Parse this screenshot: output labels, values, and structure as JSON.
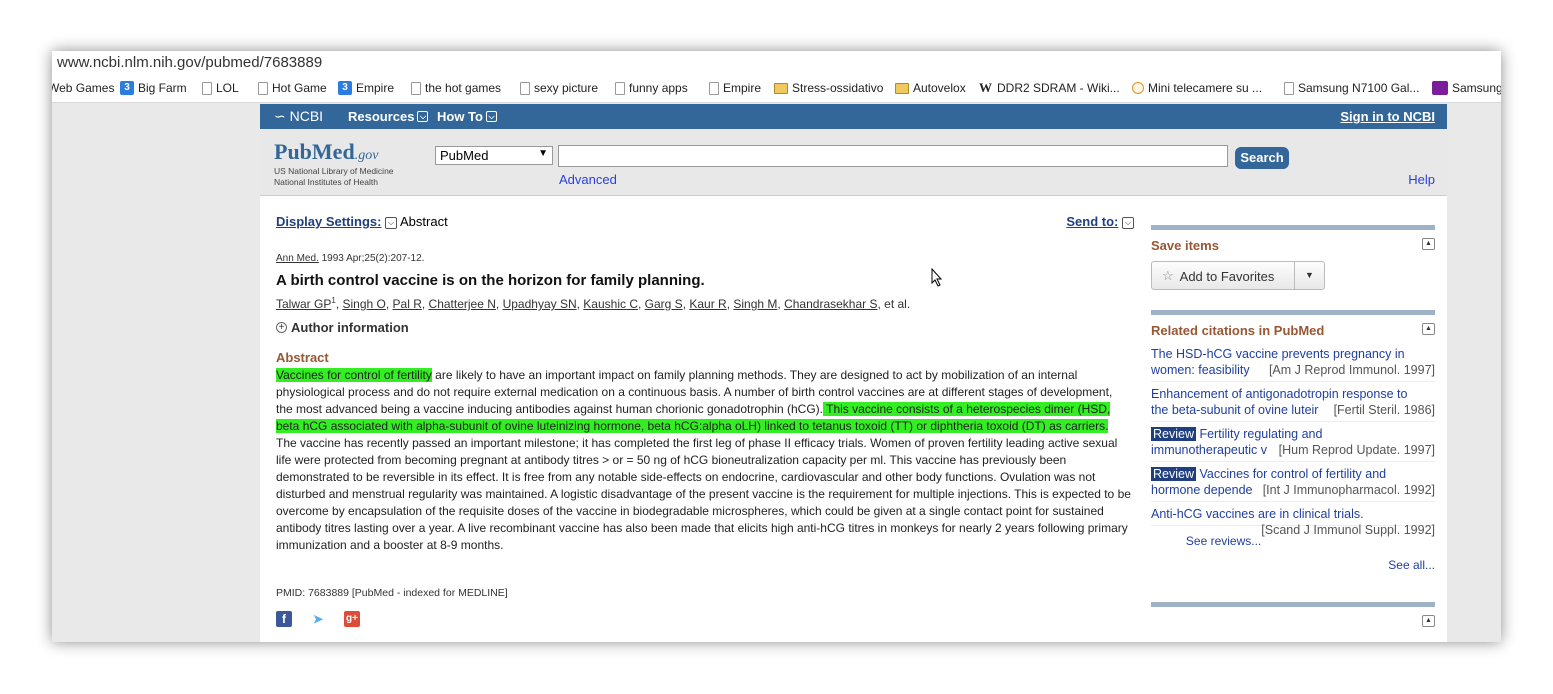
{
  "browser": {
    "url": "www.ncbi.nlm.nih.gov/pubmed/7683889",
    "bookmarks": [
      {
        "label": "Web Games",
        "icon": "page-icon"
      },
      {
        "label": "Big Farm",
        "icon": "game-icon"
      },
      {
        "label": "LOL",
        "icon": "page-icon"
      },
      {
        "label": "Hot Game",
        "icon": "page-icon"
      },
      {
        "label": "Empire",
        "icon": "game-icon"
      },
      {
        "label": "the hot games",
        "icon": "page-icon"
      },
      {
        "label": "sexy picture",
        "icon": "page-icon"
      },
      {
        "label": "funny apps",
        "icon": "page-icon"
      },
      {
        "label": "Empire",
        "icon": "page-icon"
      },
      {
        "label": "Stress-ossidativo",
        "icon": "folder-icon"
      },
      {
        "label": "Autovelox",
        "icon": "folder-icon"
      },
      {
        "label": "DDR2 SDRAM - Wiki...",
        "icon": "wikipedia-icon"
      },
      {
        "label": "Mini telecamere su ...",
        "icon": "camera-icon"
      },
      {
        "label": "Samsung N7100 Gal...",
        "icon": "page-icon"
      },
      {
        "label": "Samsung",
        "icon": "samsung-icon"
      }
    ]
  },
  "ncbi": {
    "logo": "NCBI",
    "resources": "Resources",
    "howto": "How To",
    "signin": "Sign in to NCBI"
  },
  "search": {
    "logo_pub": "Pub",
    "logo_med": "Med",
    "logo_gov": ".gov",
    "logo_sub1": "US National Library of Medicine",
    "logo_sub2": "National Institutes of Health",
    "db": "PubMed",
    "query": "",
    "button": "Search",
    "advanced": "Advanced",
    "help": "Help"
  },
  "article": {
    "display_settings": "Display Settings:",
    "format": "Abstract",
    "send_to": "Send to:",
    "journal": "Ann Med.",
    "citation": "1993 Apr;25(2):207-12.",
    "title": "A birth control vaccine is on the horizon for family planning.",
    "authors": [
      "Talwar GP",
      "Singh O",
      "Pal R",
      "Chatterjee N",
      "Upadhyay SN",
      "Kaushic C",
      "Garg S",
      "Kaur R",
      "Singh M",
      "Chandrasekhar S"
    ],
    "first_author_sup": "1",
    "et_al": ", et al.",
    "author_info": "Author information",
    "abstract_heading": "Abstract",
    "abstract_parts": [
      {
        "text": "Vaccines for control of fertility",
        "highlight": true
      },
      {
        "text": " are likely to have an important impact on family planning methods. They are designed to act by mobilization of an internal physiological process and do not require external medication on a continuous basis. A number of birth control vaccines are at different stages of development, the most advanced being a vaccine inducing antibodies against human chorionic gonadotrophin (hCG).",
        "highlight": false
      },
      {
        "text": " This vaccine consists of a heterospecies dimer (HSD, beta hCG associated with alpha-subunit of ovine luteinizing hormone, beta hCG:alpha oLH) linked to tetanus toxoid (TT) or diphtheria toxoid (DT) as carriers.",
        "highlight": true
      },
      {
        "text": " The vaccine has recently passed an important milestone; it has completed the first leg of phase II efficacy trials. Women of proven fertility leading active sexual life were protected from becoming pregnant at antibody titres > or = 50 ng of hCG bioneutralization capacity per ml. This vaccine has previously been demonstrated to be reversible in its effect. It is free from any notable side-effects on endocrine, cardiovascular and other body functions. Ovulation was not disturbed and menstrual regularity was maintained. A logistic disadvantage of the present vaccine is the requirement for multiple injections. This is expected to be overcome by encapsulation of the requisite doses of the vaccine in biodegradable microspheres, which could be given at a single contact point for sustained antibody titres lasting over a year. A live recombinant vaccine has also been made that elicits high anti-hCG titres in monkeys for nearly 2 years following primary immunization and a booster at 8-9 months.",
        "highlight": false
      }
    ],
    "pmid": "PMID: 7683889 [PubMed - indexed for MEDLINE]"
  },
  "sidebar": {
    "save_items": "Save items",
    "add_favorites": "Add to Favorites",
    "related_heading": "Related citations in PubMed",
    "related": [
      {
        "review": "",
        "line1": "The HSD-hCG vaccine prevents pregnancy in",
        "line2": "women: feasibility",
        "source": "[Am J Reprod Immunol. 1997]"
      },
      {
        "review": "",
        "line1": "Enhancement of antigonadotropin response to",
        "line2": "the beta-subunit of ovine luteir",
        "source": "[Fertil Steril. 1986]"
      },
      {
        "review": "Review",
        "line1": " Fertility regulating and",
        "line2": "immunotherapeutic v",
        "source": "[Hum Reprod Update. 1997]"
      },
      {
        "review": "Review",
        "line1": " Vaccines for control of fertility and",
        "line2": "hormone depende",
        "source": "[Int J Immunopharmacol. 1992]"
      },
      {
        "review": "",
        "line1": "Anti-hCG vaccines are in clinical trials.",
        "line2": "",
        "source": "[Scand J Immunol Suppl. 1992]"
      }
    ],
    "see_reviews": "See reviews...",
    "see_all": "See all..."
  }
}
